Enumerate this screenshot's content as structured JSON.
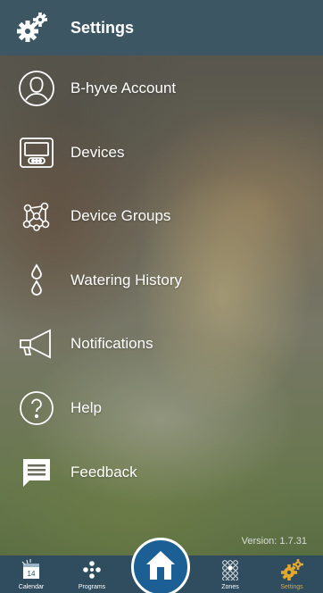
{
  "header": {
    "title": "Settings",
    "icon": "gears-icon"
  },
  "menu": [
    {
      "label": "B-hyve Account",
      "icon": "account-icon"
    },
    {
      "label": "Devices",
      "icon": "controller-device-icon"
    },
    {
      "label": "Device Groups",
      "icon": "device-groups-icon"
    },
    {
      "label": "Watering History",
      "icon": "water-drops-icon"
    },
    {
      "label": "Notifications",
      "icon": "megaphone-icon"
    },
    {
      "label": "Help",
      "icon": "help-icon"
    },
    {
      "label": "Feedback",
      "icon": "feedback-icon"
    }
  ],
  "version": "Version: 1.7.31",
  "tabbar": {
    "tabs": [
      {
        "label": "Calendar",
        "icon": "calendar-icon",
        "badge": "14"
      },
      {
        "label": "Programs",
        "icon": "programs-icon"
      },
      {
        "label": "Zones",
        "icon": "zones-icon"
      },
      {
        "label": "Settings",
        "icon": "settings-gears-icon",
        "active": true
      }
    ],
    "home_icon": "home-icon"
  },
  "colors": {
    "header": "#3d5664",
    "tabbar": "#2f4d5e",
    "home_button": "#1c5f95",
    "active_tab": "#e3a82c"
  }
}
